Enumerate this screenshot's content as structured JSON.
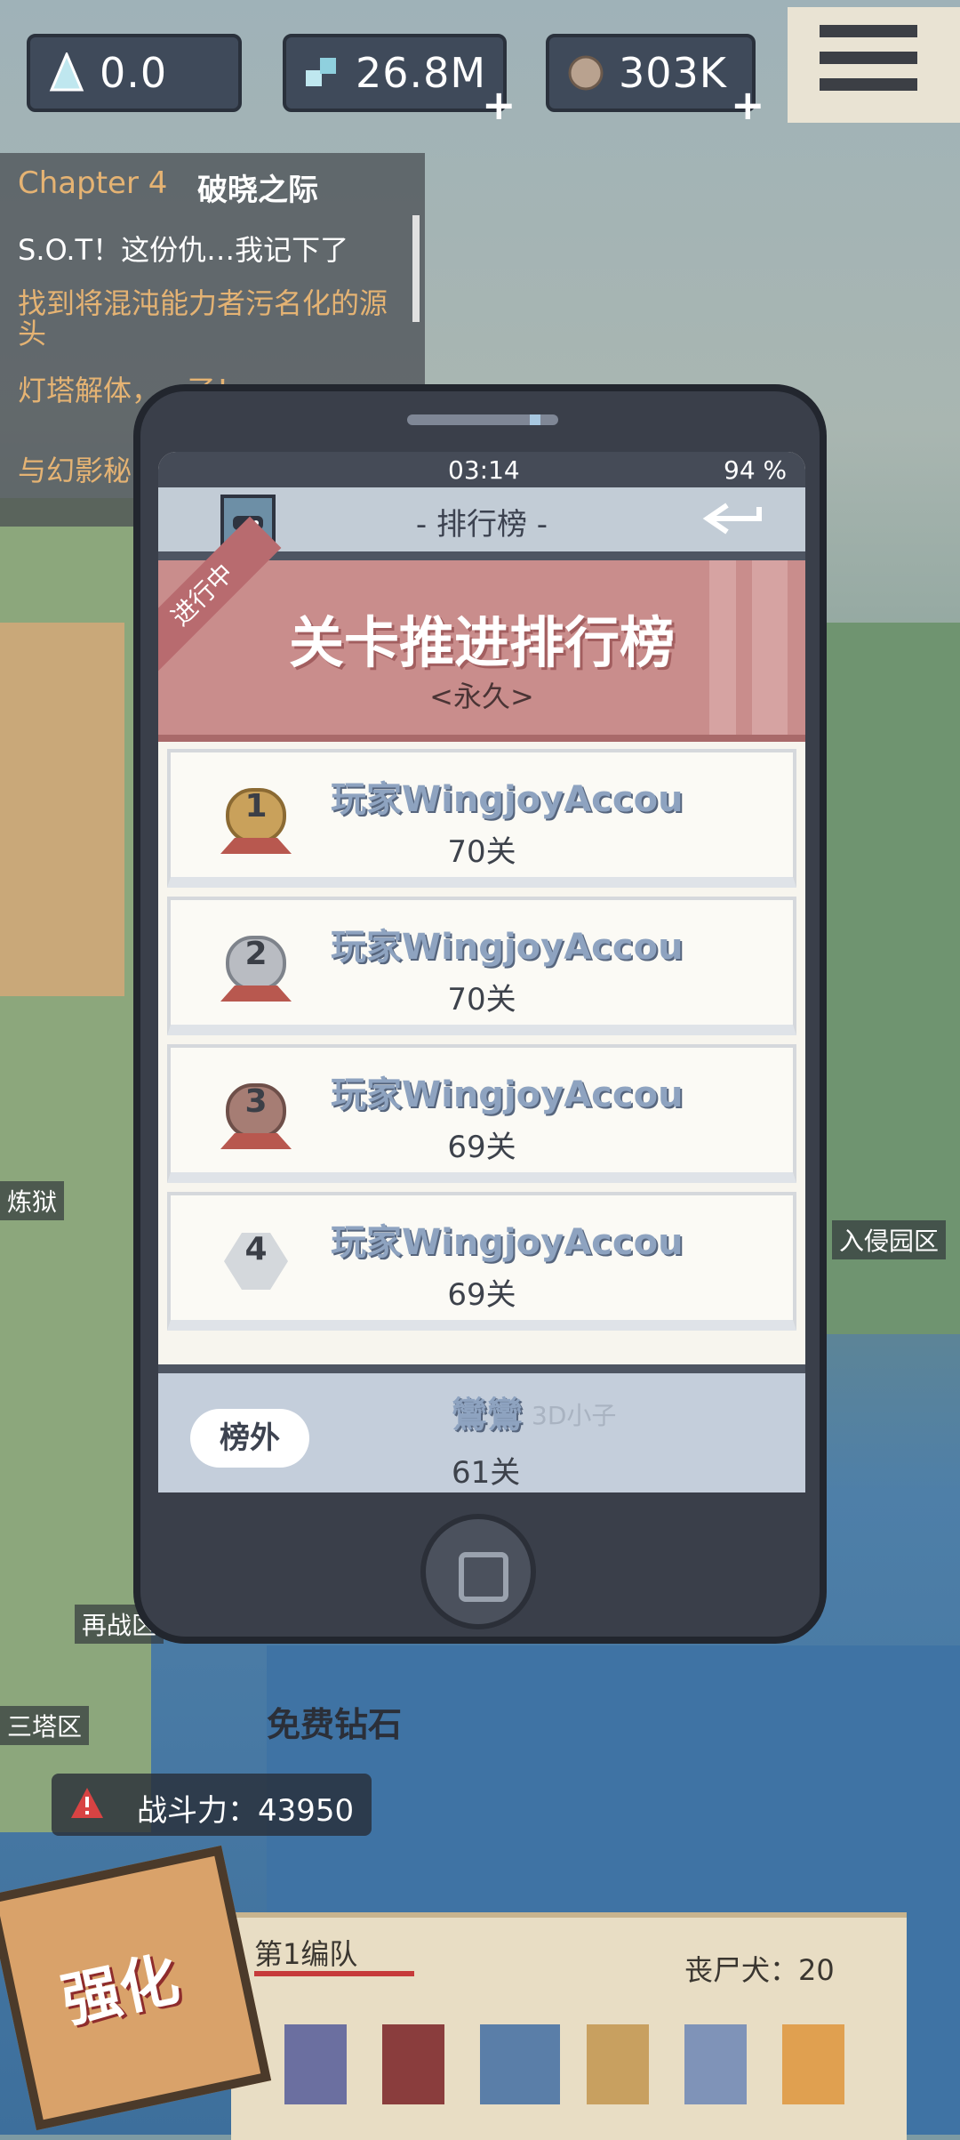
{
  "hud": {
    "resource1": {
      "value": "0.0",
      "icon": "crystal-icon"
    },
    "resource2": {
      "value": "26.8M",
      "icon": "gem-cluster-icon",
      "add_label": "+"
    },
    "resource3": {
      "value": "303K",
      "icon": "ore-icon",
      "add_label": "+"
    },
    "menu_icon": "hamburger-menu-icon"
  },
  "quest": {
    "chapter": "Chapter 4",
    "chapter_name": "破晓之际",
    "lines": [
      "S.O.T！这份仇…我记下了",
      "找到将混沌能力者污名化的源头",
      "灯塔解体，...了！",
      "与幻影秘..."
    ]
  },
  "phone": {
    "status": {
      "time": "03:14",
      "battery": "94 %"
    },
    "nav": {
      "title": "- 排行榜 -",
      "back_icon": "back-arrow-icon",
      "avatar_icon": "gamepad-avatar-icon"
    },
    "banner": {
      "ribbon": "进行中",
      "title": "关卡推进排行榜",
      "subtitle": "<永久>"
    },
    "ranks": [
      {
        "rank": "1",
        "name": "玩家WingjoyAccou",
        "stage": "70关",
        "medal_color": "#c9a15b"
      },
      {
        "rank": "2",
        "name": "玩家WingjoyAccou",
        "stage": "70关",
        "medal_color": "#b9bcc2"
      },
      {
        "rank": "3",
        "name": "玩家WingjoyAccou",
        "stage": "69关",
        "medal_color": "#a67d74"
      },
      {
        "rank": "4",
        "name": "玩家WingjoyAccou",
        "stage": "69关",
        "medal_color": "#d4d8dc"
      }
    ],
    "my_rank": {
      "tag": "榜外",
      "name": "鸞鸞",
      "sub": "3D小子",
      "stage": "61关"
    }
  },
  "map": {
    "labels": [
      "炼狱",
      "入侵园区",
      "再战区",
      "三塔区"
    ],
    "free_gem": "免费钻石",
    "power": "战斗力：43950"
  },
  "team": {
    "label": "第1编队",
    "dog": "丧尸犬：20",
    "upgrade": "强化"
  }
}
